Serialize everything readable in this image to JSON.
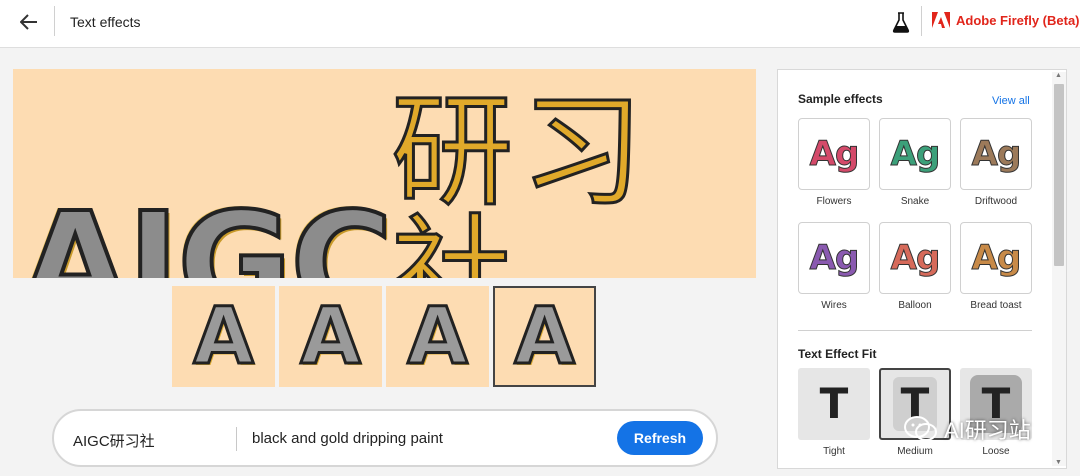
{
  "header": {
    "title": "Text effects",
    "brand": "Adobe Firefly (Beta)",
    "icons": [
      "back-arrow-icon",
      "flask-icon",
      "adobe-logo-icon"
    ]
  },
  "preview": {
    "main_text_latin": "AIGC",
    "main_text_cjk": "研习社",
    "thumb_letters": [
      "A",
      "A",
      "A",
      "A"
    ],
    "selected_thumbnail_index": 3,
    "background_color": "#fddcb2"
  },
  "prompt": {
    "text_input": "AIGC研习社",
    "effect_prompt": "black and gold dripping paint",
    "refresh_label": "Refresh"
  },
  "panel": {
    "sample_effects_heading": "Sample effects",
    "view_all_label": "View all",
    "effects": [
      {
        "label": "Flowers",
        "sample": "Ag",
        "color": "#d44a6a"
      },
      {
        "label": "Snake",
        "sample": "Ag",
        "color": "#3ca07a"
      },
      {
        "label": "Driftwood",
        "sample": "Ag",
        "color": "#9c7a5a"
      },
      {
        "label": "Wires",
        "sample": "Ag",
        "color": "#8a5ab0"
      },
      {
        "label": "Balloon",
        "sample": "Ag",
        "color": "#d66a5a"
      },
      {
        "label": "Bread toast",
        "sample": "Ag",
        "color": "#c88a48"
      }
    ],
    "fit_heading": "Text Effect Fit",
    "fits": [
      {
        "label": "Tight",
        "sample": "T"
      },
      {
        "label": "Medium",
        "sample": "T"
      },
      {
        "label": "Loose",
        "sample": "T"
      }
    ],
    "selected_fit_index": 1
  },
  "watermark": {
    "text": "AI研习站"
  },
  "colors": {
    "accent": "#1473e6",
    "brand": "#e1251b"
  }
}
